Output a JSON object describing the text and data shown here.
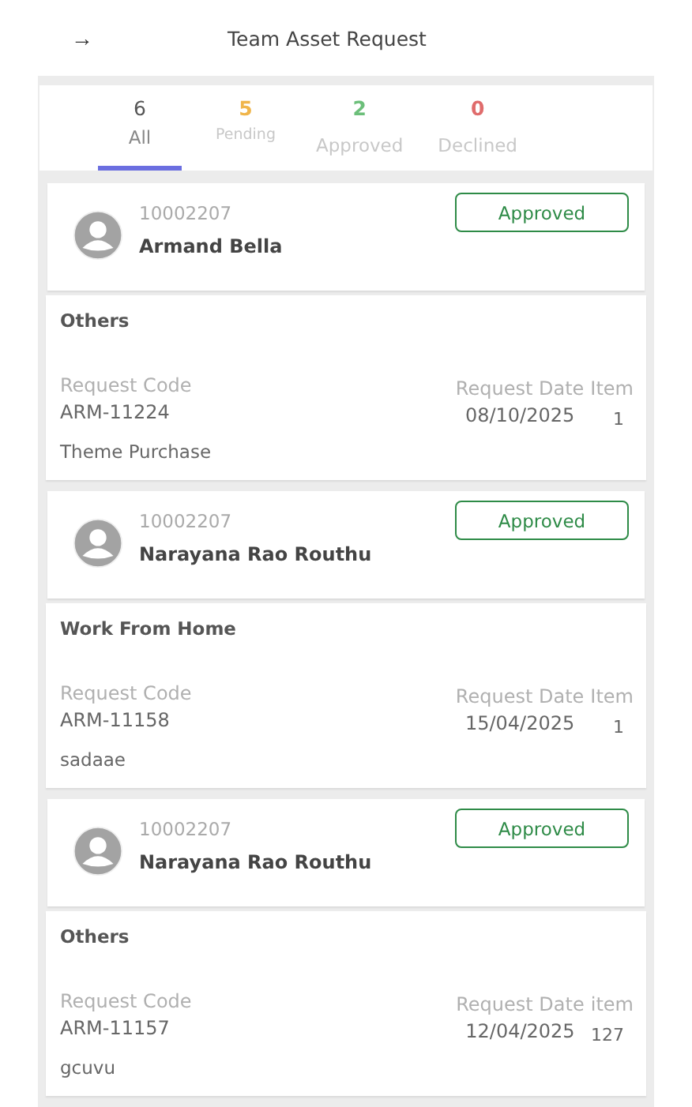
{
  "header": {
    "back_icon": "→",
    "title": "Team Asset Request"
  },
  "tabs": [
    {
      "count": "6",
      "label": "All",
      "selected": true,
      "color": "#555555"
    },
    {
      "count": "5",
      "label": "Pending",
      "selected": false,
      "color": "#f0b54a"
    },
    {
      "count": "2",
      "label": "Approved",
      "selected": false,
      "color": "#6cbf7a"
    },
    {
      "count": "0",
      "label": "Declined",
      "selected": false,
      "color": "#e06c6c"
    }
  ],
  "requests": [
    {
      "employee_id": "10002207",
      "name": "Armand Bella",
      "status": "Approved",
      "category": "Others",
      "code_label": "Request Code",
      "code": "ARM-11224",
      "date_label": "Request Date",
      "date": "08/10/2025",
      "item_label": "Item",
      "item": "1",
      "note": "Theme Purchase"
    },
    {
      "employee_id": "10002207",
      "name": "Narayana Rao Routhu",
      "status": "Approved",
      "category": "Work From Home",
      "code_label": "Request Code",
      "code": "ARM-11158",
      "date_label": "Request Date",
      "date": "15/04/2025",
      "item_label": "Item",
      "item": "1",
      "note": "sadaae"
    },
    {
      "employee_id": "10002207",
      "name": "Narayana Rao Routhu",
      "status": "Approved",
      "category": "Others",
      "code_label": "Request Code",
      "code": "ARM-11157",
      "date_label": "Request Date",
      "date": "12/04/2025",
      "item_label": "item",
      "item": "127",
      "note": "gcuvu"
    }
  ]
}
